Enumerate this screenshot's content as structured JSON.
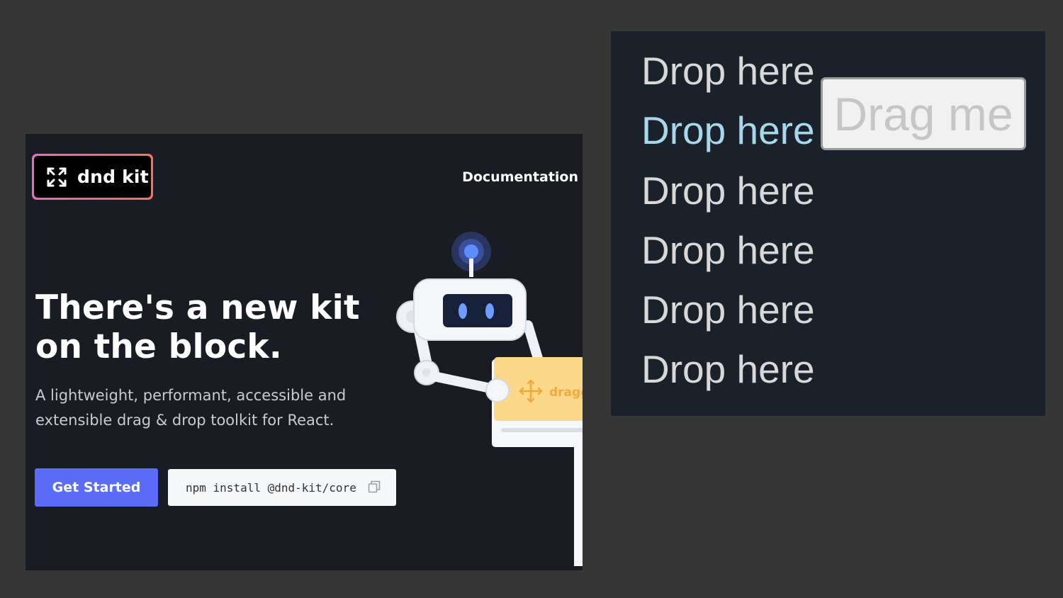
{
  "site": {
    "brand": "dnd kit",
    "nav_link": "Documentation",
    "hero_title_line1": "There's a new kit",
    "hero_title_line2": "on the block.",
    "hero_subtitle_line1": "A lightweight, performant, accessible and",
    "hero_subtitle_line2": "extensible drag & drop toolkit for React.",
    "cta_label": "Get Started",
    "install_command": "npm install @dnd-kit/core",
    "robot_card_label": "dragg",
    "colors": {
      "accent": "#5b6cf8",
      "background": "#1a1c23",
      "logo_gradient_start": "#e86bc4",
      "logo_gradient_end": "#f4745a"
    },
    "icons": [
      "drag-arrows-icon",
      "copy-icon",
      "move-icon"
    ]
  },
  "drop_panel": {
    "items": [
      {
        "label": "Drop here",
        "active": false
      },
      {
        "label": "Drop here",
        "active": true
      },
      {
        "label": "Drop here",
        "active": false
      },
      {
        "label": "Drop here",
        "active": false
      },
      {
        "label": "Drop here",
        "active": false
      },
      {
        "label": "Drop here",
        "active": false
      }
    ],
    "draggable_label": "Drag me",
    "colors": {
      "background": "#1b212a",
      "text": "#d8d8d8",
      "active_text": "#a6d8ea"
    }
  }
}
